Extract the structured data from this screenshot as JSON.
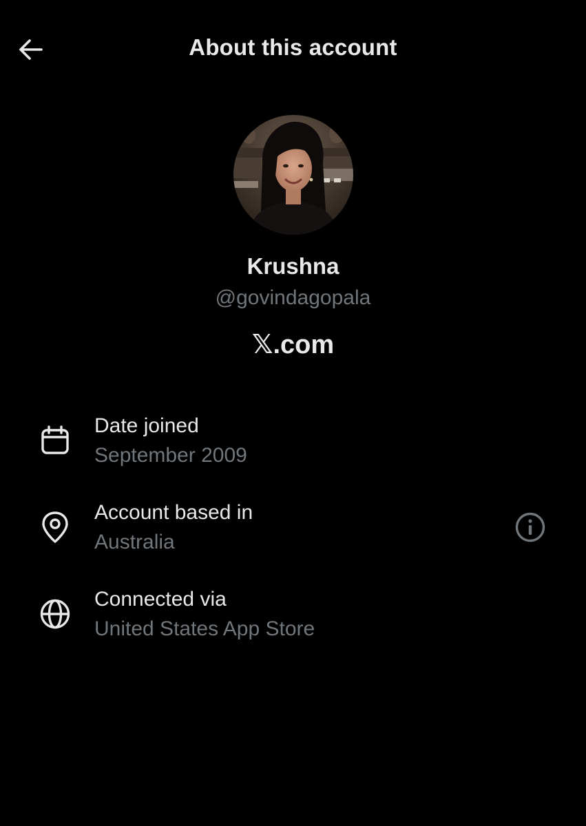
{
  "header": {
    "title": "About this account",
    "back_icon": "arrow-left-icon"
  },
  "profile": {
    "display_name": "Krushna",
    "handle": "@govindagopala",
    "domain": "𝕏.com"
  },
  "details": [
    {
      "icon": "calendar-icon",
      "label": "Date joined",
      "value": "September 2009"
    },
    {
      "icon": "location-pin-icon",
      "label": "Account based in",
      "value": "Australia"
    },
    {
      "icon": "globe-icon",
      "label": "Connected via",
      "value": "United States App Store"
    }
  ],
  "colors": {
    "background": "#000000",
    "primary_text": "#e7e9ea",
    "secondary_text": "#71767b"
  }
}
